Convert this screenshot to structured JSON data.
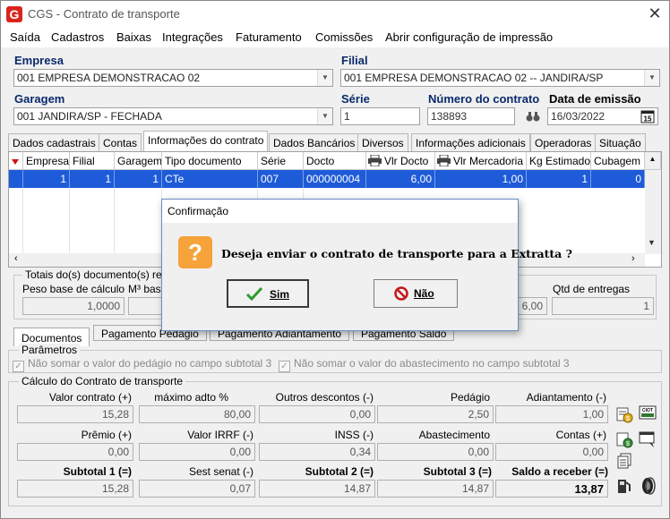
{
  "window": {
    "title": "CGS - Contrato de transporte",
    "close_glyph": "✕",
    "logo_letter": "G"
  },
  "menu": [
    "Saída",
    "Cadastros",
    "Baixas",
    "Integrações",
    "Faturamento",
    "Comissões",
    "Abrir configuração de impressão"
  ],
  "header": {
    "empresa_label": "Empresa",
    "empresa_value": "001 EMPRESA DEMONSTRACAO 02",
    "filial_label": "Filial",
    "filial_value": "001 EMPRESA DEMONSTRACAO 02 -- JANDIRA/SP",
    "garagem_label": "Garagem",
    "garagem_value": "001 JANDIRA/SP - FECHADA",
    "serie_label": "Série",
    "serie_value": "1",
    "numero_label": "Número do contrato",
    "numero_value": "138893",
    "data_label": "Data de emissão",
    "data_value": "16/03/2022"
  },
  "tabs": [
    "Dados cadastrais",
    "Contas",
    "Informações do contrato",
    "Dados Bancários",
    "Diversos",
    "Informações adicionais",
    "Operadoras",
    "Situação"
  ],
  "grid": {
    "columns": [
      "Empresa",
      "Filial",
      "Garagem",
      "Tipo documento",
      "Série",
      "Docto",
      "Vlr Docto",
      "Vlr Mercadoria",
      "Kg Estimado",
      "Cubagem"
    ],
    "row": [
      "1",
      "1",
      "1",
      "CTe",
      "007",
      "000000004",
      "6,00",
      "1,00",
      "1",
      "0"
    ]
  },
  "totais": {
    "group_label": "Totais do(s) documento(s) rela",
    "peso_label": "Peso base de cálculo",
    "peso_value": "1,0000",
    "m3_label": "M³ base",
    "right_value": "6,00",
    "entregas_label": "Qtd de entregas",
    "entregas_value": "1"
  },
  "bottom_tabs": [
    "Documentos",
    "Pagamento Pedágio",
    "Pagamento Adiantamento",
    "Pagamento Saldo"
  ],
  "parametros": {
    "label": "Parâmetros",
    "opt1": "Não somar o valor do pedágio no campo subtotal 3",
    "opt2": "Não somar o valor do abastecimento no campo subtotal 3"
  },
  "calculo": {
    "label": "Cálculo do Contrato de transporte",
    "row1": [
      {
        "l": "Valor contrato (+)",
        "v": "15,28"
      },
      {
        "l": "máximo adto %",
        "v": "80,00"
      },
      {
        "l": "Outros descontos (-)",
        "v": "0,00"
      },
      {
        "l": "Pedágio",
        "v": "2,50"
      },
      {
        "l": "Adiantamento (-)",
        "v": "1,00"
      }
    ],
    "row2": [
      {
        "l": "Prêmio (+)",
        "v": "0,00"
      },
      {
        "l": "Valor IRRF (-)",
        "v": "0,00"
      },
      {
        "l": "INSS (-)",
        "v": "0,34"
      },
      {
        "l": "Abastecimento",
        "v": "0,00"
      },
      {
        "l": "Contas (+)",
        "v": "0,00"
      }
    ],
    "row3": [
      {
        "l": "Subtotal 1 (=)",
        "v": "15,28"
      },
      {
        "l": "Sest senat (-)",
        "v": "0,07"
      },
      {
        "l": "Subtotal 2 (=)",
        "v": "14,87"
      },
      {
        "l": "Subtotal 3 (=)",
        "v": "14,87"
      },
      {
        "l": "Saldo a receber (=)",
        "v": "13,87"
      }
    ],
    "ciot_label": "CIOT"
  },
  "dialog": {
    "title": "Confirmação",
    "icon_glyph": "?",
    "message": "Deseja enviar o contrato de transporte para a Extratta ?",
    "yes": "Sim",
    "no": "Não"
  }
}
